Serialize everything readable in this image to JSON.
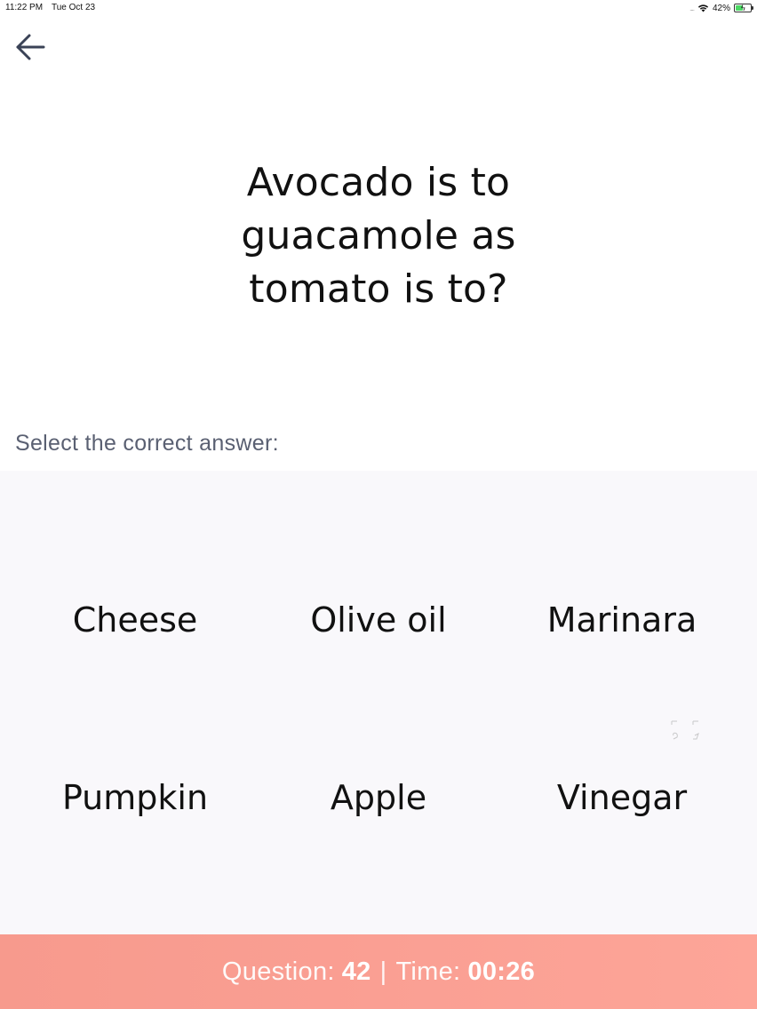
{
  "status_bar": {
    "time": "11:22 PM",
    "date": "Tue Oct 23",
    "signal": "....",
    "battery_percent": "42%",
    "wifi_icon": "wifi-icon",
    "battery_icon": "battery-charging-icon"
  },
  "nav": {
    "back_icon": "arrow-left-icon"
  },
  "question": {
    "lines": [
      "Avocado is to",
      "guacamole as",
      "tomato is to?"
    ]
  },
  "prompt": "Select the correct answer:",
  "answers": [
    "Cheese",
    "Olive oil",
    "Marinara",
    "Pumpkin",
    "Apple",
    "Vinegar"
  ],
  "footer": {
    "question_label": "Question:",
    "question_number": "42",
    "separator": "|",
    "time_label": "Time:",
    "time_value": "00:26"
  },
  "colors": {
    "footer_gradient_start": "#f79a8d",
    "footer_gradient_end": "#fda598",
    "answers_background": "#f9f8fb",
    "prompt_text": "#5a6072",
    "back_arrow": "#3a4256"
  }
}
